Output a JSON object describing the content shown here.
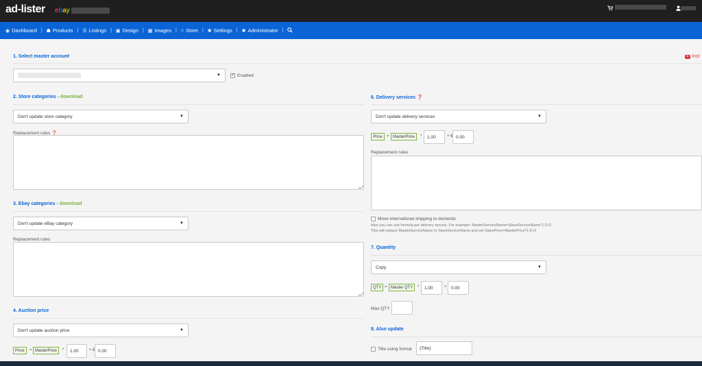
{
  "header": {
    "logo_text": "ad-lister",
    "ebay_brand": {
      "e": "e",
      "b": "b",
      "a": "a",
      "y": "y"
    }
  },
  "nav": {
    "items": [
      {
        "label": "Dashboard",
        "icon": "dashboard-icon",
        "glyph": "◉"
      },
      {
        "label": "Products",
        "icon": "products-icon",
        "glyph": "☗"
      },
      {
        "label": "Listings",
        "icon": "listings-icon",
        "glyph": "☰"
      },
      {
        "label": "Design",
        "icon": "design-icon",
        "glyph": "▣"
      },
      {
        "label": "Images",
        "icon": "images-icon",
        "glyph": "▦"
      },
      {
        "label": "Store",
        "icon": "store-icon",
        "glyph": "⌂"
      },
      {
        "label": "Settings",
        "icon": "gear-icon",
        "glyph": "✱"
      },
      {
        "label": "Administrator",
        "icon": "administrator-icon",
        "glyph": "✱"
      }
    ]
  },
  "instructions_link": "Inst",
  "sections": {
    "master_account": {
      "title": "1. Select master account",
      "enabled_label": "Enabled"
    },
    "store_categories": {
      "title": "2. Store categories - ",
      "download": "download",
      "select_value": "Don't update store category",
      "replacement_label": "Replacement rules"
    },
    "ebay_categories": {
      "title": "3. Ebay categories - ",
      "download": "download",
      "select_value": "Don't update eBay category",
      "replacement_label": "Replacement rules"
    },
    "auction_price": {
      "title": "4. Auction price",
      "select_value": "Don't update auction price",
      "price_chip": "Price",
      "eq": "=",
      "master_chip": "MasterPrice",
      "mult": "*",
      "mult_value": "1.00",
      "plus_currency": "+ €",
      "add_value": "0.00"
    },
    "delivery": {
      "title": "6. Delivery services",
      "select_value": "Don't update delivery services",
      "price_chip": "Price",
      "eq": "=",
      "master_chip": "MasterPrice",
      "mult": "*",
      "mult_value": "1.00",
      "plus_currency": "+ €",
      "add_value": "0.00",
      "replacement_label": "Replacement rules",
      "move_intl_label": "Move international shipping to domestic",
      "note_line1": "Also you can use formula per delivery service. For example: MasterServiceName=SlaveServiceName*1.5+2",
      "note_line2": "This will replace MasterServiceName to SlaveServiceName and set SlavePrice=MasterPrice*1.5+2"
    },
    "quantity": {
      "title": "7. Quantity",
      "select_value": "Copy",
      "qty_chip": "QTY",
      "eq": "=",
      "master_chip": "Master QTY",
      "mult": "*",
      "mult_value": "1.00",
      "plus": "+",
      "add_value": "0.00",
      "max_qty_label": "Max QTY",
      "max_qty_value": ""
    },
    "also_update": {
      "title": "8. Also update",
      "title_format_label": "Title using format",
      "title_format_value": "{Title}"
    }
  },
  "colors": {
    "nav_bg": "#0a64d6",
    "topbar_bg": "#1f1f1f",
    "section_title": "#0a64d6",
    "download_link": "#7cb342"
  }
}
